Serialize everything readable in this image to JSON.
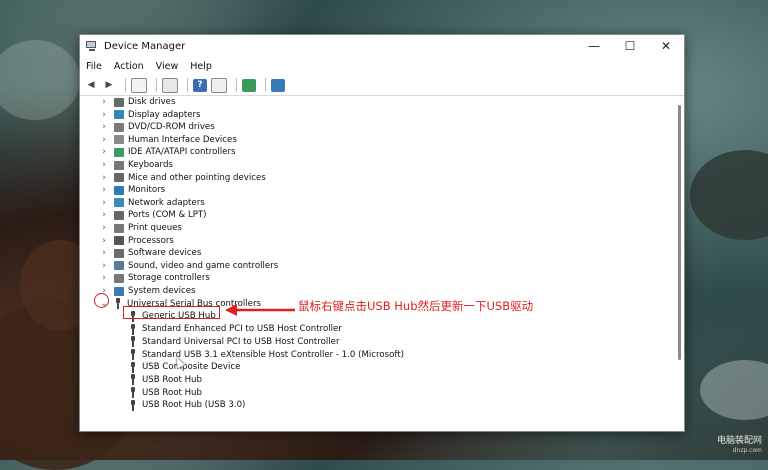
{
  "window": {
    "title": "Device Manager",
    "min_glyph": "—",
    "max_glyph": "☐",
    "close_glyph": "✕"
  },
  "menu": [
    "File",
    "Action",
    "View",
    "Help"
  ],
  "toolbar_icons": [
    "back-icon",
    "forward-icon",
    "properties-icon",
    "list-icon",
    "help-icon",
    "view-icon",
    "update-driver-icon",
    "scan-icon"
  ],
  "tree": {
    "categories": [
      {
        "label": "Disk drives",
        "icon": "disk-drive-icon",
        "color": "#6a6a6a"
      },
      {
        "label": "Display adapters",
        "icon": "display-adapter-icon",
        "color": "#2e8bb8"
      },
      {
        "label": "DVD/CD-ROM drives",
        "icon": "dvd-drive-icon",
        "color": "#7a7a7a"
      },
      {
        "label": "Human Interface Devices",
        "icon": "hid-icon",
        "color": "#8a8a8a"
      },
      {
        "label": "IDE ATA/ATAPI controllers",
        "icon": "ide-controller-icon",
        "color": "#3a9a6a"
      },
      {
        "label": "Keyboards",
        "icon": "keyboard-icon",
        "color": "#777777"
      },
      {
        "label": "Mice and other pointing devices",
        "icon": "mouse-icon",
        "color": "#666666"
      },
      {
        "label": "Monitors",
        "icon": "monitor-icon",
        "color": "#2e7bb0"
      },
      {
        "label": "Network adapters",
        "icon": "network-adapter-icon",
        "color": "#3a8ac0"
      },
      {
        "label": "Ports (COM & LPT)",
        "icon": "ports-icon",
        "color": "#666666"
      },
      {
        "label": "Print queues",
        "icon": "printer-icon",
        "color": "#777777"
      },
      {
        "label": "Processors",
        "icon": "processor-icon",
        "color": "#555555"
      },
      {
        "label": "Software devices",
        "icon": "software-device-icon",
        "color": "#6a6a6a"
      },
      {
        "label": "Sound, video and game controllers",
        "icon": "sound-icon",
        "color": "#5a7a9a"
      },
      {
        "label": "Storage controllers",
        "icon": "storage-controller-icon",
        "color": "#777777"
      },
      {
        "label": "System devices",
        "icon": "system-devices-icon",
        "color": "#3a7ab0"
      }
    ],
    "usb": {
      "label": "Universal Serial Bus controllers",
      "expand_glyph": "⌄",
      "children": [
        "Generic USB Hub",
        "Standard Enhanced PCI to USB Host Controller",
        "Standard Universal PCI to USB Host Controller",
        "Standard USB 3.1 eXtensible Host Controller - 1.0 (Microsoft)",
        "USB Composite Device",
        "USB Root Hub",
        "USB Root Hub",
        "USB Root Hub (USB 3.0)"
      ]
    }
  },
  "annotation": {
    "text": "鼠标右键点击USB Hub然后更新一下USB驱动",
    "color": "#e02020"
  },
  "watermark": {
    "line1": "电脑装配网",
    "line2": "dnzp.com"
  }
}
